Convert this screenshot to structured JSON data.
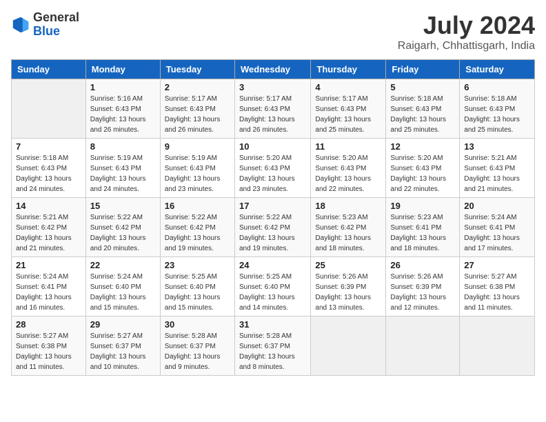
{
  "header": {
    "logo_general": "General",
    "logo_blue": "Blue",
    "title": "July 2024",
    "location": "Raigarh, Chhattisgarh, India"
  },
  "days_of_week": [
    "Sunday",
    "Monday",
    "Tuesday",
    "Wednesday",
    "Thursday",
    "Friday",
    "Saturday"
  ],
  "weeks": [
    [
      {
        "day": "",
        "sunrise": "",
        "sunset": "",
        "daylight": ""
      },
      {
        "day": "1",
        "sunrise": "Sunrise: 5:16 AM",
        "sunset": "Sunset: 6:43 PM",
        "daylight": "Daylight: 13 hours and 26 minutes."
      },
      {
        "day": "2",
        "sunrise": "Sunrise: 5:17 AM",
        "sunset": "Sunset: 6:43 PM",
        "daylight": "Daylight: 13 hours and 26 minutes."
      },
      {
        "day": "3",
        "sunrise": "Sunrise: 5:17 AM",
        "sunset": "Sunset: 6:43 PM",
        "daylight": "Daylight: 13 hours and 26 minutes."
      },
      {
        "day": "4",
        "sunrise": "Sunrise: 5:17 AM",
        "sunset": "Sunset: 6:43 PM",
        "daylight": "Daylight: 13 hours and 25 minutes."
      },
      {
        "day": "5",
        "sunrise": "Sunrise: 5:18 AM",
        "sunset": "Sunset: 6:43 PM",
        "daylight": "Daylight: 13 hours and 25 minutes."
      },
      {
        "day": "6",
        "sunrise": "Sunrise: 5:18 AM",
        "sunset": "Sunset: 6:43 PM",
        "daylight": "Daylight: 13 hours and 25 minutes."
      }
    ],
    [
      {
        "day": "7",
        "sunrise": "Sunrise: 5:18 AM",
        "sunset": "Sunset: 6:43 PM",
        "daylight": "Daylight: 13 hours and 24 minutes."
      },
      {
        "day": "8",
        "sunrise": "Sunrise: 5:19 AM",
        "sunset": "Sunset: 6:43 PM",
        "daylight": "Daylight: 13 hours and 24 minutes."
      },
      {
        "day": "9",
        "sunrise": "Sunrise: 5:19 AM",
        "sunset": "Sunset: 6:43 PM",
        "daylight": "Daylight: 13 hours and 23 minutes."
      },
      {
        "day": "10",
        "sunrise": "Sunrise: 5:20 AM",
        "sunset": "Sunset: 6:43 PM",
        "daylight": "Daylight: 13 hours and 23 minutes."
      },
      {
        "day": "11",
        "sunrise": "Sunrise: 5:20 AM",
        "sunset": "Sunset: 6:43 PM",
        "daylight": "Daylight: 13 hours and 22 minutes."
      },
      {
        "day": "12",
        "sunrise": "Sunrise: 5:20 AM",
        "sunset": "Sunset: 6:43 PM",
        "daylight": "Daylight: 13 hours and 22 minutes."
      },
      {
        "day": "13",
        "sunrise": "Sunrise: 5:21 AM",
        "sunset": "Sunset: 6:43 PM",
        "daylight": "Daylight: 13 hours and 21 minutes."
      }
    ],
    [
      {
        "day": "14",
        "sunrise": "Sunrise: 5:21 AM",
        "sunset": "Sunset: 6:42 PM",
        "daylight": "Daylight: 13 hours and 21 minutes."
      },
      {
        "day": "15",
        "sunrise": "Sunrise: 5:22 AM",
        "sunset": "Sunset: 6:42 PM",
        "daylight": "Daylight: 13 hours and 20 minutes."
      },
      {
        "day": "16",
        "sunrise": "Sunrise: 5:22 AM",
        "sunset": "Sunset: 6:42 PM",
        "daylight": "Daylight: 13 hours and 19 minutes."
      },
      {
        "day": "17",
        "sunrise": "Sunrise: 5:22 AM",
        "sunset": "Sunset: 6:42 PM",
        "daylight": "Daylight: 13 hours and 19 minutes."
      },
      {
        "day": "18",
        "sunrise": "Sunrise: 5:23 AM",
        "sunset": "Sunset: 6:42 PM",
        "daylight": "Daylight: 13 hours and 18 minutes."
      },
      {
        "day": "19",
        "sunrise": "Sunrise: 5:23 AM",
        "sunset": "Sunset: 6:41 PM",
        "daylight": "Daylight: 13 hours and 18 minutes."
      },
      {
        "day": "20",
        "sunrise": "Sunrise: 5:24 AM",
        "sunset": "Sunset: 6:41 PM",
        "daylight": "Daylight: 13 hours and 17 minutes."
      }
    ],
    [
      {
        "day": "21",
        "sunrise": "Sunrise: 5:24 AM",
        "sunset": "Sunset: 6:41 PM",
        "daylight": "Daylight: 13 hours and 16 minutes."
      },
      {
        "day": "22",
        "sunrise": "Sunrise: 5:24 AM",
        "sunset": "Sunset: 6:40 PM",
        "daylight": "Daylight: 13 hours and 15 minutes."
      },
      {
        "day": "23",
        "sunrise": "Sunrise: 5:25 AM",
        "sunset": "Sunset: 6:40 PM",
        "daylight": "Daylight: 13 hours and 15 minutes."
      },
      {
        "day": "24",
        "sunrise": "Sunrise: 5:25 AM",
        "sunset": "Sunset: 6:40 PM",
        "daylight": "Daylight: 13 hours and 14 minutes."
      },
      {
        "day": "25",
        "sunrise": "Sunrise: 5:26 AM",
        "sunset": "Sunset: 6:39 PM",
        "daylight": "Daylight: 13 hours and 13 minutes."
      },
      {
        "day": "26",
        "sunrise": "Sunrise: 5:26 AM",
        "sunset": "Sunset: 6:39 PM",
        "daylight": "Daylight: 13 hours and 12 minutes."
      },
      {
        "day": "27",
        "sunrise": "Sunrise: 5:27 AM",
        "sunset": "Sunset: 6:38 PM",
        "daylight": "Daylight: 13 hours and 11 minutes."
      }
    ],
    [
      {
        "day": "28",
        "sunrise": "Sunrise: 5:27 AM",
        "sunset": "Sunset: 6:38 PM",
        "daylight": "Daylight: 13 hours and 11 minutes."
      },
      {
        "day": "29",
        "sunrise": "Sunrise: 5:27 AM",
        "sunset": "Sunset: 6:37 PM",
        "daylight": "Daylight: 13 hours and 10 minutes."
      },
      {
        "day": "30",
        "sunrise": "Sunrise: 5:28 AM",
        "sunset": "Sunset: 6:37 PM",
        "daylight": "Daylight: 13 hours and 9 minutes."
      },
      {
        "day": "31",
        "sunrise": "Sunrise: 5:28 AM",
        "sunset": "Sunset: 6:37 PM",
        "daylight": "Daylight: 13 hours and 8 minutes."
      },
      {
        "day": "",
        "sunrise": "",
        "sunset": "",
        "daylight": ""
      },
      {
        "day": "",
        "sunrise": "",
        "sunset": "",
        "daylight": ""
      },
      {
        "day": "",
        "sunrise": "",
        "sunset": "",
        "daylight": ""
      }
    ]
  ]
}
